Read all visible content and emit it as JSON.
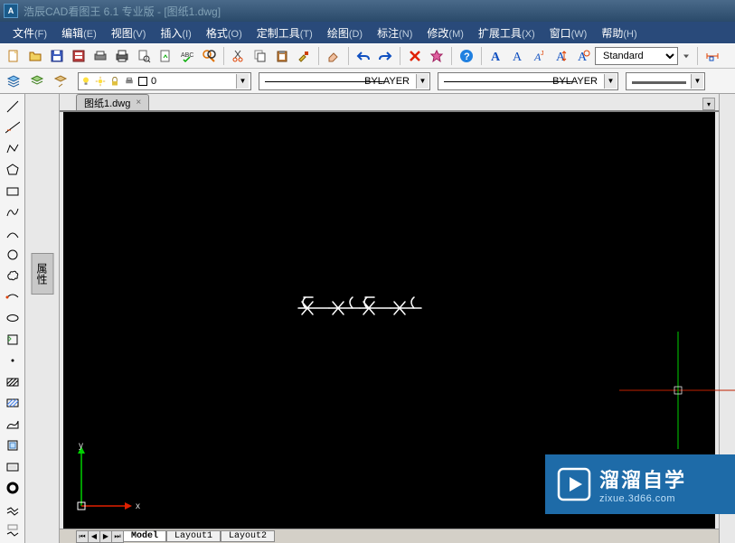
{
  "title": "浩辰CAD看图王 6.1 专业版 - [图纸1.dwg]",
  "menus": [
    {
      "label": "文件",
      "hotkey": "(F)"
    },
    {
      "label": "编辑",
      "hotkey": "(E)"
    },
    {
      "label": "视图",
      "hotkey": "(V)"
    },
    {
      "label": "插入",
      "hotkey": "(I)"
    },
    {
      "label": "格式",
      "hotkey": "(O)"
    },
    {
      "label": "定制工具",
      "hotkey": "(T)"
    },
    {
      "label": "绘图",
      "hotkey": "(D)"
    },
    {
      "label": "标注",
      "hotkey": "(N)"
    },
    {
      "label": "修改",
      "hotkey": "(M)"
    },
    {
      "label": "扩展工具",
      "hotkey": "(X)"
    },
    {
      "label": "窗口",
      "hotkey": "(W)"
    },
    {
      "label": "帮助",
      "hotkey": "(H)"
    }
  ],
  "text_style": "Standard",
  "layer": {
    "name": "0"
  },
  "linetype": "BYLAYER",
  "lineweight": "BYLAYER",
  "doc_tab": {
    "name": "图纸1.dwg",
    "close": "×"
  },
  "properties_label": "属性",
  "layout_tabs": {
    "model": "Model",
    "l1": "Layout1",
    "l2": "Layout2"
  },
  "ucs": {
    "x": "x",
    "y": "y"
  },
  "watermark": {
    "main": "溜溜自学",
    "sub": "zixue.3d66.com"
  }
}
